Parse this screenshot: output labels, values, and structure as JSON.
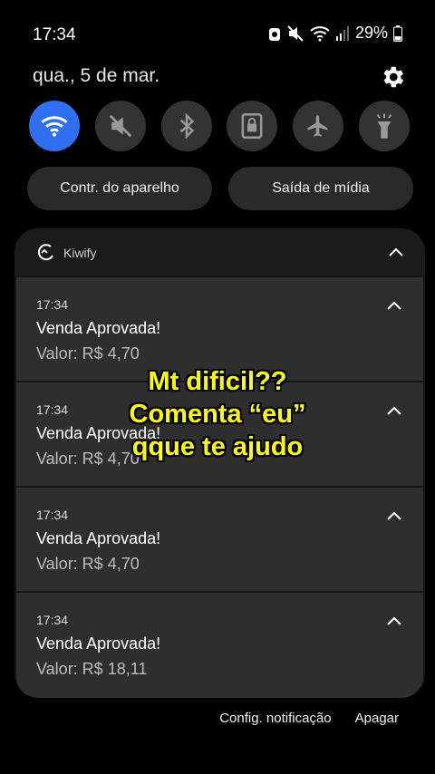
{
  "status_bar": {
    "time": "17:34",
    "battery": "29%"
  },
  "date": "qua., 5 de mar.",
  "quick_settings": [
    {
      "icon": "wifi-icon",
      "active": true
    },
    {
      "icon": "mute-icon",
      "active": false
    },
    {
      "icon": "bluetooth-icon",
      "active": false
    },
    {
      "icon": "screen-lock-icon",
      "active": false
    },
    {
      "icon": "airplane-icon",
      "active": false
    },
    {
      "icon": "flashlight-icon",
      "active": false
    }
  ],
  "pills": {
    "device_control": "Contr. do aparelho",
    "media_output": "Saída de mídia"
  },
  "app": {
    "name": "Kiwify"
  },
  "notifications": [
    {
      "time": "17:34",
      "title": "Venda Aprovada!",
      "value": "Valor: R$ 4,70"
    },
    {
      "time": "17:34",
      "title": "Venda Aprovada!",
      "value": "Valor: R$ 4,70"
    },
    {
      "time": "17:34",
      "title": "Venda Aprovada!",
      "value": "Valor: R$ 4,70"
    },
    {
      "time": "17:34",
      "title": "Venda Aprovada!",
      "value": "Valor: R$ 18,11"
    }
  ],
  "footer": {
    "settings": "Config. notificação",
    "clear": "Apagar"
  },
  "overlay": {
    "line1": "Mt dificil??",
    "line2": "Comenta “eu”",
    "line3": "qque te ajudo"
  }
}
